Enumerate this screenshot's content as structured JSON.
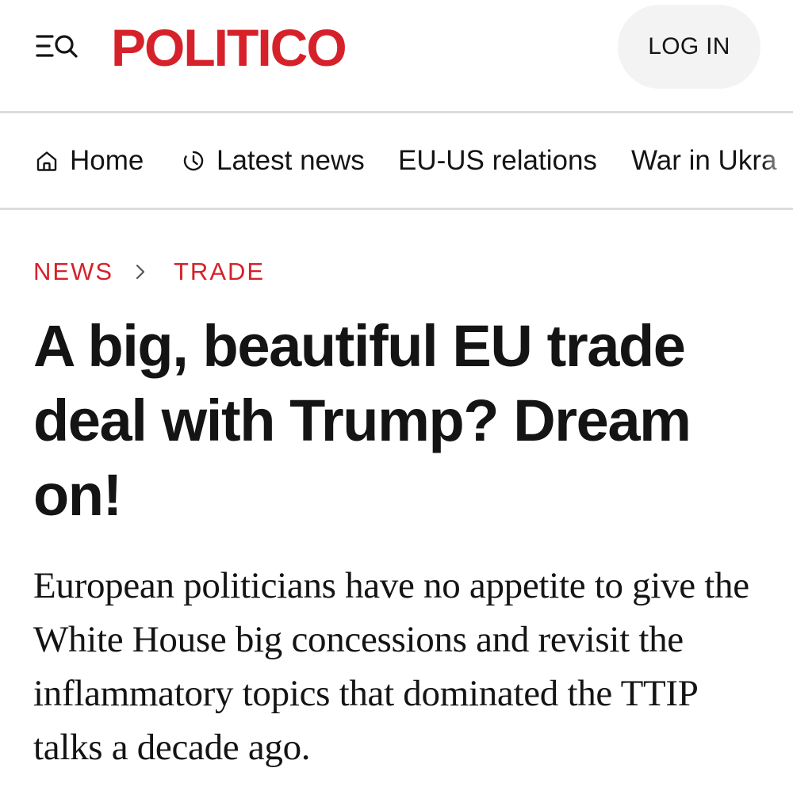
{
  "header": {
    "logo_text": "POLITICO",
    "login_label": "LOG IN",
    "menu_icon": "menu-search-icon"
  },
  "nav": {
    "items": [
      {
        "label": "Home",
        "icon": "home-icon"
      },
      {
        "label": "Latest news",
        "icon": "clock-icon"
      },
      {
        "label": "EU-US relations"
      },
      {
        "label": "War in Ukra"
      }
    ]
  },
  "breadcrumb": {
    "section": "NEWS",
    "subsection": "TRADE"
  },
  "article": {
    "headline": "A big, beautiful EU trade deal with Trump? Dream on!",
    "dek": "European politicians have no appetite to give the White House big concessions and revisit the inflammatory topics that dominated the TTIP talks a decade ago."
  },
  "colors": {
    "brand_red": "#d6212a",
    "text": "#141414",
    "button_bg": "#f3f3f3",
    "divider": "#dcdcdc"
  }
}
